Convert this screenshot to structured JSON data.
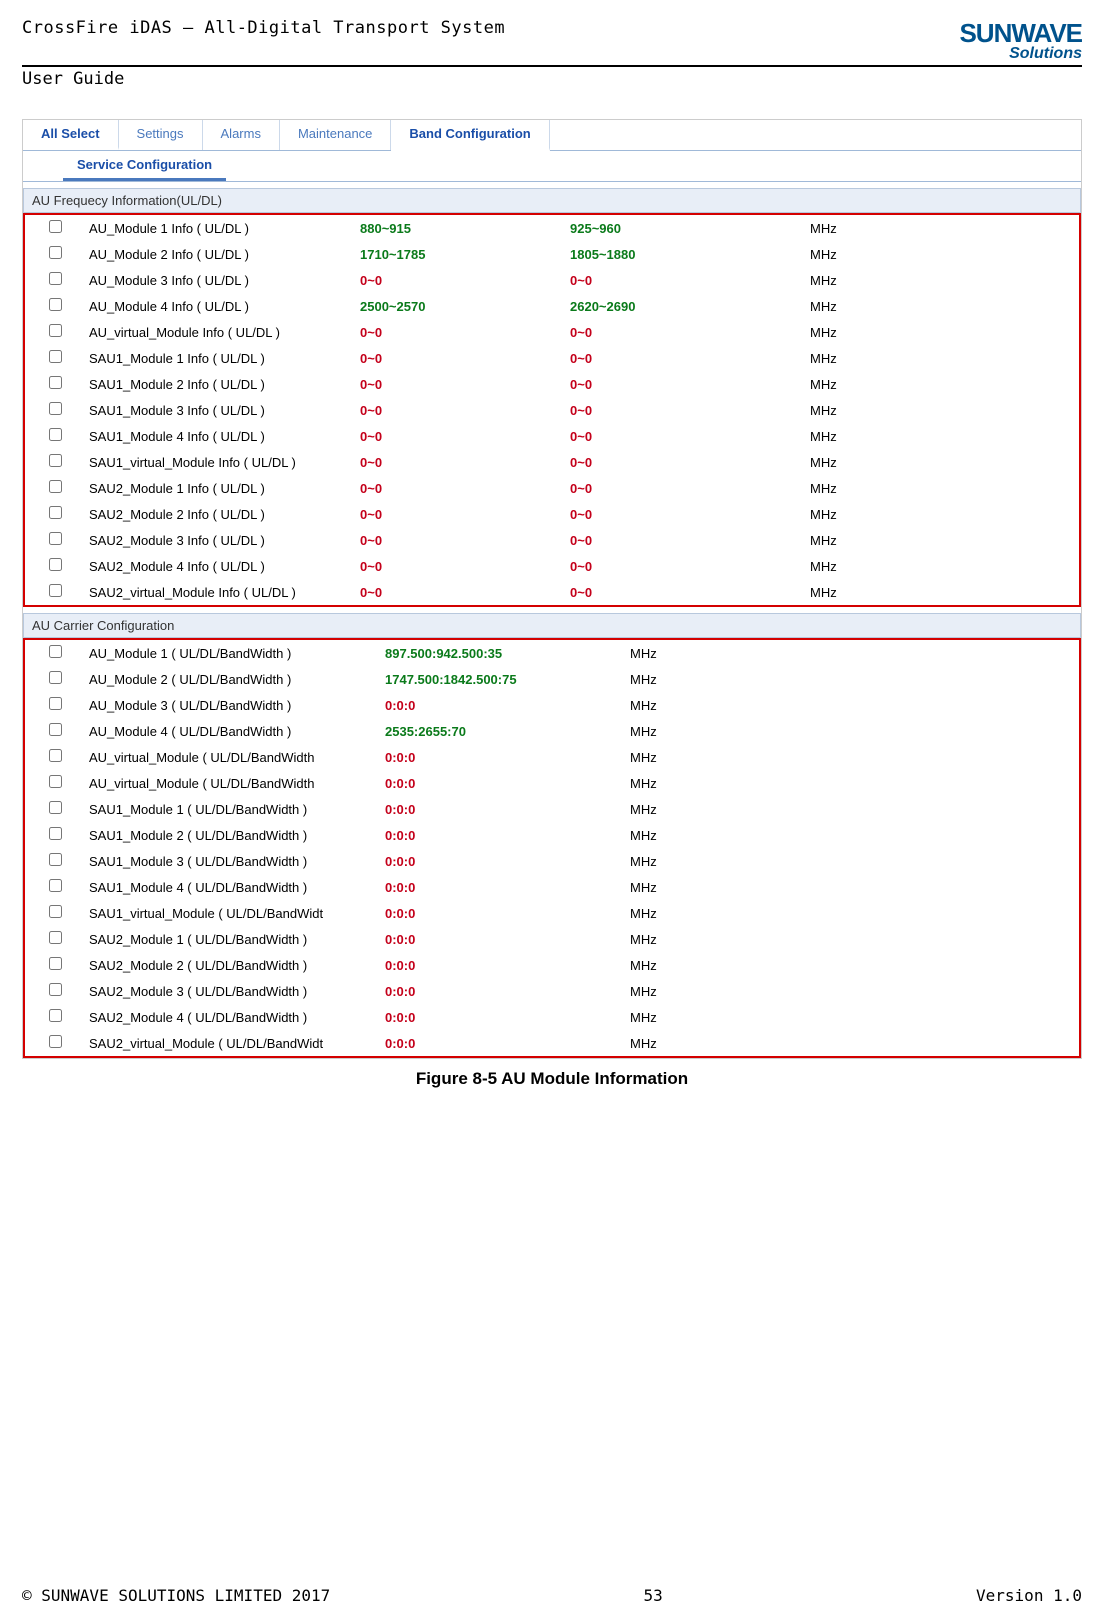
{
  "header": {
    "title": "CrossFire iDAS – All-Digital Transport System",
    "subtitle": "User Guide",
    "logo_main": "SUNWAVE",
    "logo_sub": "Solutions"
  },
  "tabs1": {
    "allselect": "All Select",
    "settings": "Settings",
    "alarms": "Alarms",
    "maintenance": "Maintenance",
    "bandconfig": "Band Configuration"
  },
  "tabs2": {
    "service": "Service Configuration"
  },
  "section1_title": "AU Frequecy Information(UL/DL)",
  "freq_rows": [
    {
      "name": "AU_Module 1 Info ( UL/DL )",
      "v1": "880~915",
      "v2": "925~960",
      "cls": "green",
      "unit": "MHz"
    },
    {
      "name": "AU_Module 2 Info ( UL/DL )",
      "v1": "1710~1785",
      "v2": "1805~1880",
      "cls": "green",
      "unit": "MHz"
    },
    {
      "name": "AU_Module 3 Info ( UL/DL )",
      "v1": "0~0",
      "v2": "0~0",
      "cls": "red",
      "unit": "MHz"
    },
    {
      "name": "AU_Module 4 Info ( UL/DL )",
      "v1": "2500~2570",
      "v2": "2620~2690",
      "cls": "green",
      "unit": "MHz"
    },
    {
      "name": "AU_virtual_Module Info ( UL/DL )",
      "v1": "0~0",
      "v2": "0~0",
      "cls": "red",
      "unit": "MHz"
    },
    {
      "name": "SAU1_Module 1 Info ( UL/DL )",
      "v1": "0~0",
      "v2": "0~0",
      "cls": "red",
      "unit": "MHz"
    },
    {
      "name": "SAU1_Module 2 Info ( UL/DL )",
      "v1": "0~0",
      "v2": "0~0",
      "cls": "red",
      "unit": "MHz"
    },
    {
      "name": "SAU1_Module 3 Info ( UL/DL )",
      "v1": "0~0",
      "v2": "0~0",
      "cls": "red",
      "unit": "MHz"
    },
    {
      "name": "SAU1_Module 4 Info ( UL/DL )",
      "v1": "0~0",
      "v2": "0~0",
      "cls": "red",
      "unit": "MHz"
    },
    {
      "name": "SAU1_virtual_Module Info ( UL/DL )",
      "v1": "0~0",
      "v2": "0~0",
      "cls": "red",
      "unit": "MHz"
    },
    {
      "name": "SAU2_Module 1 Info ( UL/DL )",
      "v1": "0~0",
      "v2": "0~0",
      "cls": "red",
      "unit": "MHz"
    },
    {
      "name": "SAU2_Module 2 Info ( UL/DL )",
      "v1": "0~0",
      "v2": "0~0",
      "cls": "red",
      "unit": "MHz"
    },
    {
      "name": "SAU2_Module 3 Info ( UL/DL )",
      "v1": "0~0",
      "v2": "0~0",
      "cls": "red",
      "unit": "MHz"
    },
    {
      "name": "SAU2_Module 4 Info ( UL/DL )",
      "v1": "0~0",
      "v2": "0~0",
      "cls": "red",
      "unit": "MHz"
    },
    {
      "name": "SAU2_virtual_Module Info ( UL/DL )",
      "v1": "0~0",
      "v2": "0~0",
      "cls": "red",
      "unit": "MHz"
    }
  ],
  "section2_title": "AU Carrier Configuration",
  "carrier_rows": [
    {
      "name": "AU_Module 1 ( UL/DL/BandWidth )",
      "v1": "897.500:942.500:35",
      "cls": "green",
      "unit": "MHz"
    },
    {
      "name": "AU_Module 2 ( UL/DL/BandWidth )",
      "v1": "1747.500:1842.500:75",
      "cls": "green",
      "unit": "MHz"
    },
    {
      "name": "AU_Module 3 ( UL/DL/BandWidth )",
      "v1": "0:0:0",
      "cls": "red",
      "unit": "MHz"
    },
    {
      "name": "AU_Module 4 ( UL/DL/BandWidth )",
      "v1": "2535:2655:70",
      "cls": "green",
      "unit": "MHz"
    },
    {
      "name": "AU_virtual_Module  ( UL/DL/BandWidth",
      "v1": "0:0:0",
      "cls": "red",
      "unit": "MHz"
    },
    {
      "name": "AU_virtual_Module  ( UL/DL/BandWidth",
      "v1": "0:0:0",
      "cls": "red",
      "unit": "MHz"
    },
    {
      "name": "SAU1_Module 1 ( UL/DL/BandWidth )",
      "v1": "0:0:0",
      "cls": "red",
      "unit": "MHz"
    },
    {
      "name": "SAU1_Module 2 ( UL/DL/BandWidth )",
      "v1": "0:0:0",
      "cls": "red",
      "unit": "MHz"
    },
    {
      "name": "SAU1_Module 3 ( UL/DL/BandWidth )",
      "v1": "0:0:0",
      "cls": "red",
      "unit": "MHz"
    },
    {
      "name": "SAU1_Module 4 ( UL/DL/BandWidth )",
      "v1": "0:0:0",
      "cls": "red",
      "unit": "MHz"
    },
    {
      "name": "SAU1_virtual_Module ( UL/DL/BandWidt",
      "v1": "0:0:0",
      "cls": "red",
      "unit": "MHz"
    },
    {
      "name": "SAU2_Module 1 ( UL/DL/BandWidth )",
      "v1": "0:0:0",
      "cls": "red",
      "unit": "MHz"
    },
    {
      "name": "SAU2_Module 2 ( UL/DL/BandWidth )",
      "v1": "0:0:0",
      "cls": "red",
      "unit": "MHz"
    },
    {
      "name": "SAU2_Module 3 ( UL/DL/BandWidth )",
      "v1": "0:0:0",
      "cls": "red",
      "unit": "MHz"
    },
    {
      "name": "SAU2_Module 4 ( UL/DL/BandWidth )",
      "v1": "0:0:0",
      "cls": "red",
      "unit": "MHz"
    },
    {
      "name": "SAU2_virtual_Module ( UL/DL/BandWidt",
      "v1": "0:0:0",
      "cls": "red",
      "unit": "MHz"
    }
  ],
  "caption": "Figure 8-5 AU Module Information",
  "footer": {
    "left": "© SUNWAVE SOLUTIONS LIMITED 2017",
    "center": "53",
    "right": "Version 1.0"
  }
}
